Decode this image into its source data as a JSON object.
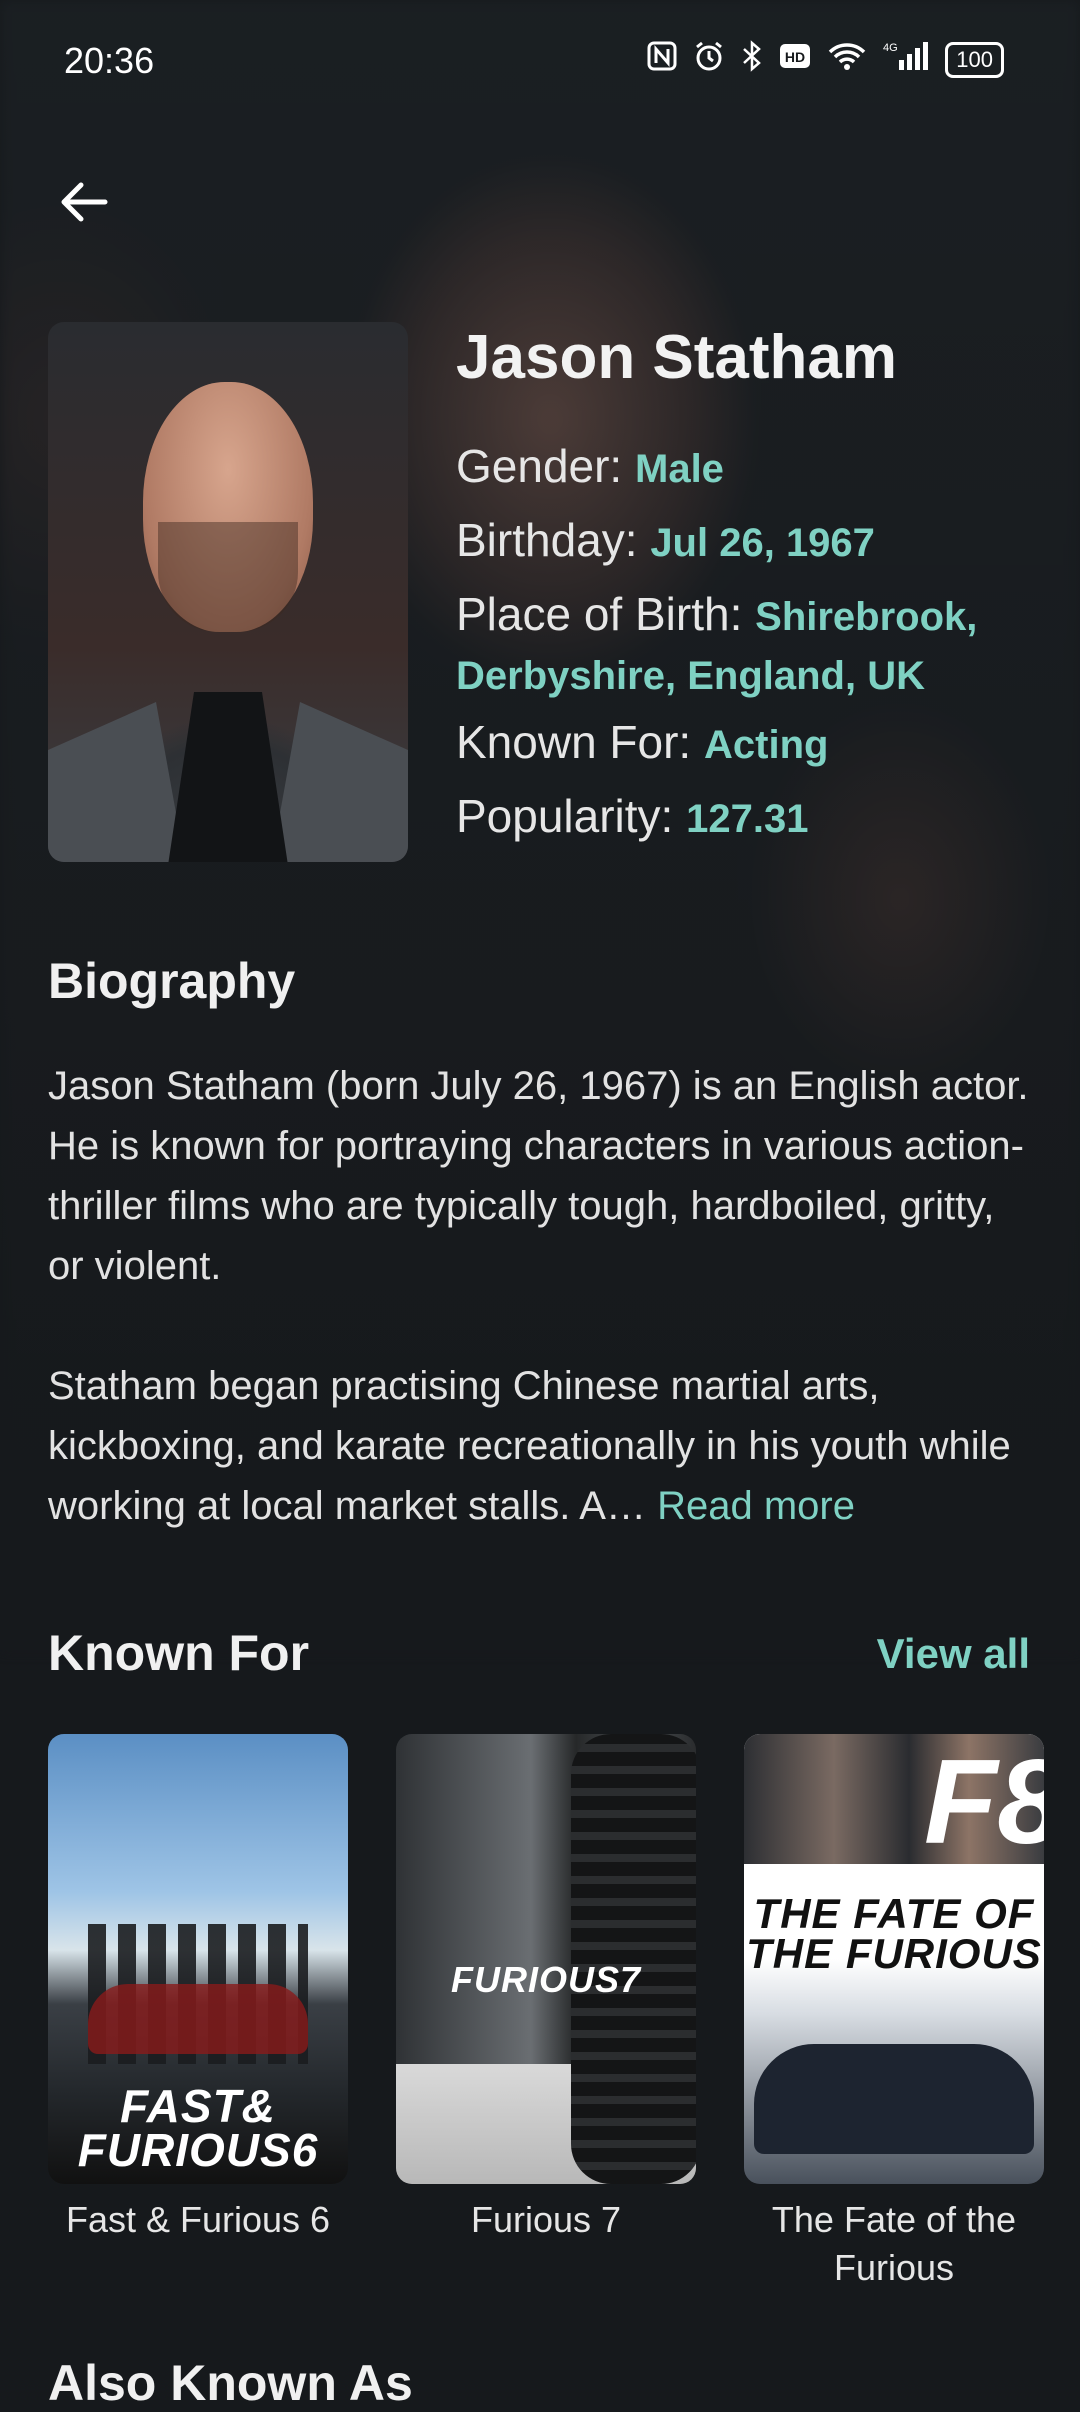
{
  "status_bar": {
    "time": "20:36",
    "battery": "100",
    "network": "4G"
  },
  "person": {
    "name": "Jason Statham",
    "gender_label": "Gender:",
    "gender": "Male",
    "birthday_label": "Birthday:",
    "birthday": "Jul 26, 1967",
    "place_label": "Place of Birth:",
    "place": "Shirebrook, Derbyshire, England, UK",
    "known_for_label": "Known For:",
    "known_for": "Acting",
    "popularity_label": "Popularity:",
    "popularity": "127.31"
  },
  "biography": {
    "title": "Biography",
    "paragraph1": "Jason Statham (born July 26, 1967) is an English actor. He is known for portraying characters in various action-thriller films who are typically tough, hardboiled, gritty, or violent.",
    "paragraph2": "Statham began practising Chinese martial arts, kickboxing, and karate recreationally in his youth while working at local market stalls. A…",
    "read_more": "Read more"
  },
  "known_for": {
    "title": "Known For",
    "view_all": "View all",
    "items": [
      {
        "caption": "Fast & Furious 6",
        "logo": "FAST& FURIOUS6"
      },
      {
        "caption": "Furious 7",
        "logo": "FURIOUS7"
      },
      {
        "caption": "The Fate of the Furious",
        "logo": "THE FATE OF THE FURIOUS",
        "badge": "F8"
      }
    ]
  },
  "also_known_as": {
    "title": "Also Known As"
  },
  "colors": {
    "accent": "#7fd1c3",
    "background": "#16191c"
  }
}
